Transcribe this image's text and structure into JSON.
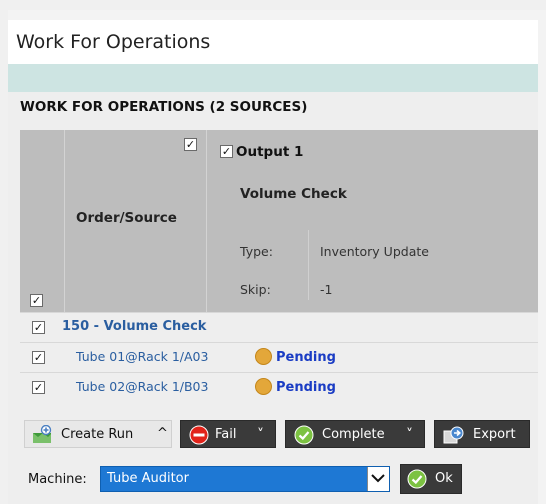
{
  "window": {
    "title": "Work For Operations"
  },
  "section": {
    "title": "WORK FOR OPERATIONS (2 SOURCES)"
  },
  "grid": {
    "order_header": "Order/Source",
    "output_label": "Output 1",
    "operation": "Volume Check",
    "type_key": "Type:",
    "type_value": "Inventory Update",
    "skip_key": "Skip:",
    "skip_value": "-1",
    "checkmark": "✓"
  },
  "group": {
    "label": "150 - Volume Check"
  },
  "rows": [
    {
      "source": "Tube 01@Rack 1/A03",
      "status": "Pending"
    },
    {
      "source": "Tube 02@Rack 1/B03",
      "status": "Pending"
    }
  ],
  "toolbar": {
    "create_run": "Create Run",
    "fail": "Fail",
    "complete": "Complete",
    "export": "Export",
    "caret_up": "^",
    "caret_down": "˅"
  },
  "machine": {
    "label": "Machine:",
    "selected": "Tube Auditor",
    "ok_label": "Ok"
  },
  "colors": {
    "accent_blue": "#2a5ea0",
    "status_pending": "#e3a73a",
    "status_text": "#1a3cc4",
    "select_blue": "#1e78d4",
    "teal_band": "#cde4e2"
  }
}
